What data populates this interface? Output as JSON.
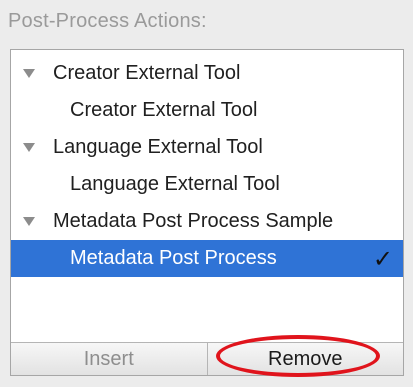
{
  "header": {
    "title": "Post-Process Actions:"
  },
  "list": {
    "groups": [
      {
        "label": "Creator External Tool",
        "items": [
          {
            "label": "Creator External Tool"
          }
        ]
      },
      {
        "label": "Language External Tool",
        "items": [
          {
            "label": "Language External Tool"
          }
        ]
      },
      {
        "label": "Metadata Post Process Sample",
        "items": [
          {
            "label": "Metadata Post Process",
            "selected": true,
            "checkmark": "✓"
          }
        ]
      }
    ]
  },
  "footer": {
    "insert_label": "Insert",
    "remove_label": "Remove",
    "annotation": "red-ellipse-highlight-on-remove",
    "annotation_color": "#e0141c"
  },
  "colors": {
    "selection": "#2f73d6",
    "header_text": "#9a9a9a"
  }
}
